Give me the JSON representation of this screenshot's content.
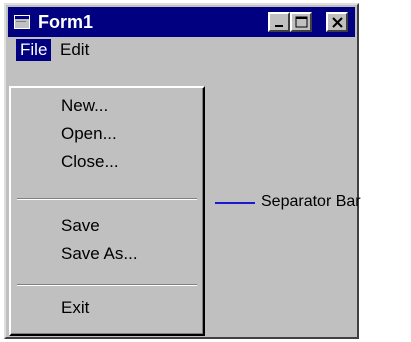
{
  "window": {
    "title": "Form1"
  },
  "menubar": {
    "file": "File",
    "edit": "Edit"
  },
  "file_menu": {
    "items": [
      "New...",
      "Open...",
      "Close...",
      "Save",
      "Save As...",
      "Exit"
    ]
  },
  "annotation": {
    "text": "Separator Bar"
  },
  "colors": {
    "title_bar": "#000080",
    "face": "#c0c0c0",
    "callout_line": "#1a1ad0"
  }
}
